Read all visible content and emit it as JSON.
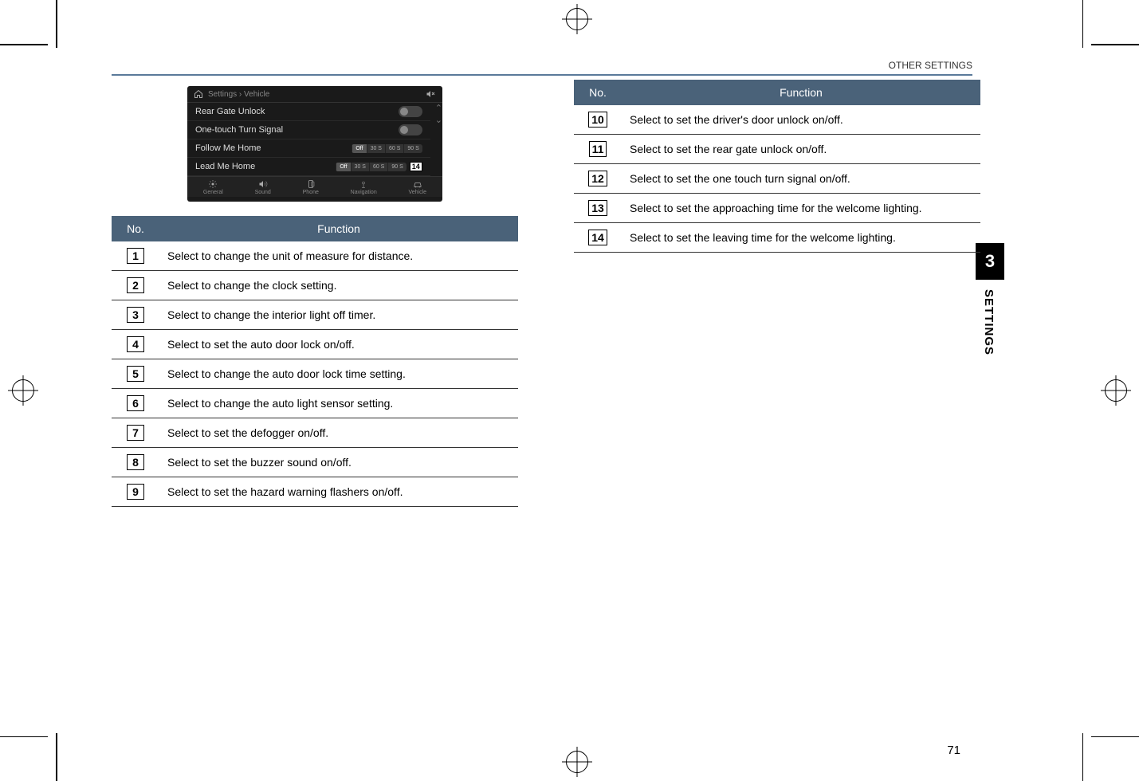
{
  "header": {
    "section": "OTHER SETTINGS"
  },
  "sidebar": {
    "chapter_num": "3",
    "chapter_label": "SETTINGS"
  },
  "page_number": "71",
  "screenshot": {
    "breadcrumb": "Settings › Vehicle",
    "rows": [
      {
        "label": "Rear Gate Unlock",
        "type": "toggle"
      },
      {
        "label": "One-touch Turn Signal",
        "type": "toggle"
      },
      {
        "label": "Follow Me Home",
        "type": "seg",
        "options": [
          "Off",
          "30 S",
          "60 S",
          "90 S"
        ],
        "selected": 0
      },
      {
        "label": "Lead Me Home",
        "type": "seg",
        "options": [
          "Off",
          "30 S",
          "60 S",
          "90 S"
        ],
        "selected": 0,
        "callout": "14"
      }
    ],
    "bottom_tabs": [
      "General",
      "Sound",
      "Phone",
      "Navigation",
      "Vehicle"
    ]
  },
  "tables": {
    "headers": {
      "no": "No.",
      "func": "Function"
    },
    "left": [
      {
        "no": "1",
        "text": "Select to change the unit of measure for distance."
      },
      {
        "no": "2",
        "text": "Select to change the clock setting."
      },
      {
        "no": "3",
        "text": "Select to change the interior light off timer."
      },
      {
        "no": "4",
        "text": "Select to set the auto door lock on/off."
      },
      {
        "no": "5",
        "text": "Select to change the auto door lock time setting."
      },
      {
        "no": "6",
        "text": "Select to change the auto light sensor setting."
      },
      {
        "no": "7",
        "text": "Select to set the defogger on/off."
      },
      {
        "no": "8",
        "text": "Select to set the buzzer sound on/off."
      },
      {
        "no": "9",
        "text": "Select to set the hazard warning flashers on/off."
      }
    ],
    "right": [
      {
        "no": "10",
        "text": "Select to set the driver's door unlock on/off."
      },
      {
        "no": "11",
        "text": "Select to set the rear gate unlock on/off."
      },
      {
        "no": "12",
        "text": "Select to set the one touch turn signal on/off."
      },
      {
        "no": "13",
        "text": "Select to set the approaching time for the welcome lighting."
      },
      {
        "no": "14",
        "text": "Select to set the leaving time for the welcome lighting."
      }
    ]
  }
}
